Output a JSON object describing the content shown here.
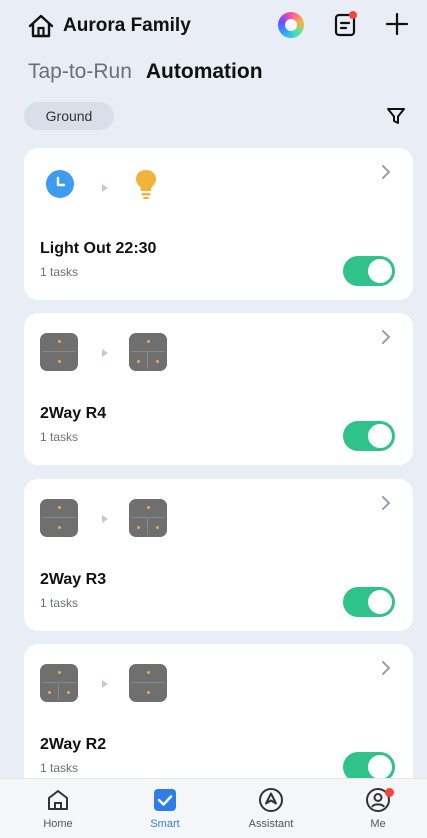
{
  "header": {
    "home_name": "Aurora Family",
    "icons": [
      "home-icon",
      "assistant-orb-icon",
      "notes-icon",
      "plus-icon"
    ],
    "notes_has_badge": true
  },
  "tabs": [
    {
      "label": "Tap-to-Run",
      "active": false
    },
    {
      "label": "Automation",
      "active": true
    }
  ],
  "room_filter": {
    "label": "Ground"
  },
  "automations": [
    {
      "name": "Light Out 22:30",
      "tasks": "1 tasks",
      "enabled": true,
      "condition_icon": "clock-icon",
      "action_icon": "bulb-icon"
    },
    {
      "name": "2Way R4",
      "tasks": "1 tasks",
      "enabled": true,
      "condition_icon": "switch-icon",
      "action_icon": "switch-icon"
    },
    {
      "name": "2Way R3",
      "tasks": "1 tasks",
      "enabled": true,
      "condition_icon": "switch-icon",
      "action_icon": "switch-icon"
    },
    {
      "name": "2Way R2",
      "tasks": "1 tasks",
      "enabled": true,
      "condition_icon": "switch-icon",
      "action_icon": "switch-icon"
    }
  ],
  "tabbar": [
    {
      "label": "Home",
      "active": false
    },
    {
      "label": "Smart",
      "active": true
    },
    {
      "label": "Assistant",
      "active": false
    },
    {
      "label": "Me",
      "active": false,
      "badge": true
    }
  ],
  "colors": {
    "accent": "#2f7ee8",
    "toggle_on": "#2fc28a",
    "badge": "#f5453a",
    "background": "#e9eef6"
  }
}
